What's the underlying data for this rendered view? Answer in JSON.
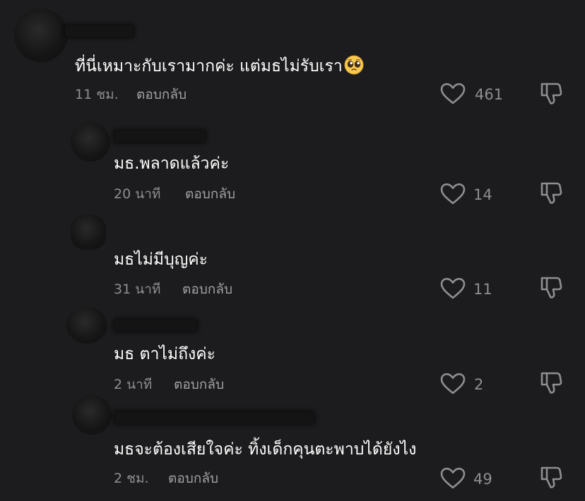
{
  "comments": [
    {
      "text": "ที่นี่เหมาะกับเรามากค่ะ แต่มธไม่รับเรา",
      "emoji": "pleading-face-emoji",
      "time": "11 ชม.",
      "reply_label": "ตอบกลับ",
      "likes": "461"
    },
    {
      "text": "มธ.พลาดแล้วค่ะ",
      "time": "20 นาที",
      "reply_label": "ตอบกลับ",
      "likes": "14"
    },
    {
      "text": "มธไม่มีบุญค่ะ",
      "time": "31 นาที",
      "reply_label": "ตอบกลับ",
      "likes": "11"
    },
    {
      "text": "มธ ตาไม่ถึงค่ะ",
      "time": "2 นาที",
      "reply_label": "ตอบกลับ",
      "likes": "2"
    },
    {
      "text": "มธจะต้องเสียใจค่ะ ทิ้งเด็กคุนตะพาบได้ยังไง",
      "time": "2 ชม.",
      "reply_label": "ตอบกลับ",
      "likes": "49"
    }
  ],
  "icons": {
    "like": "heart-outline-icon",
    "dislike": "thumbs-down-outline-icon"
  },
  "colors": {
    "background": "#1c1c1e",
    "text": "#ffffff",
    "secondary_text": "#8e8e93"
  }
}
